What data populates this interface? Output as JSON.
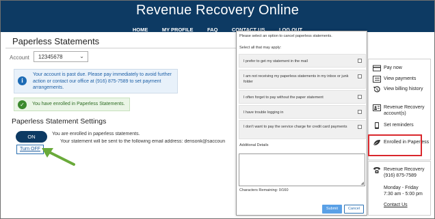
{
  "header": {
    "site_title": "Revenue Recovery Online",
    "nav": [
      "HOME",
      "MY PROFILE",
      "FAQ",
      "CONTACT US",
      "LOG OUT"
    ]
  },
  "page": {
    "title": "Paperless Statements",
    "account_label": "Account",
    "account_value": "12345678",
    "info_alert": "Your account is past due. Please pay immediately to avoid further action or contact our office at (916) 875-7589 to set payment arrangements.",
    "success_alert": "You have enrolled in Paperless Statements.",
    "settings_title": "Paperless Statement Settings",
    "toggle_label": "ON",
    "enrolled_text": "You are enrolled in paperless statements.",
    "email_text": "Your statement will be sent to the following email address:  densonk@saccoun",
    "turn_off_label": "Turn OFF"
  },
  "modal": {
    "prompt": "Please select an option to cancel paperless statements.",
    "select_all": "Select all that may apply:",
    "options": [
      "I prefer to get my statement in the mail",
      "I am not receiving my paperless statements in my inbox or junk folder",
      "I often forget to pay without the paper statement",
      "I have trouble logging in",
      "I don't want to pay the service charge for credit card payments"
    ],
    "details_label": "Additional Details",
    "details_value": "",
    "chars_remaining": "Characters Remaining: 0/160",
    "submit_label": "Submit",
    "cancel_label": "Cancel"
  },
  "sidebar": {
    "items": [
      {
        "label": "Pay now",
        "icon": "card-icon"
      },
      {
        "label": "View payments",
        "icon": "list-icon"
      },
      {
        "label": "View billing history",
        "icon": "history-icon"
      },
      {
        "label": "Revenue Recovery account(s)",
        "icon": "id-card-icon"
      },
      {
        "label": "Set reminders",
        "icon": "phone-icon"
      },
      {
        "label": "Enrolled in Paperless",
        "icon": "leaf-icon"
      }
    ],
    "contact": {
      "name": "Revenue Recovery",
      "phone": "(916) 875-7589",
      "hours_days": "Monday - Friday",
      "hours_time": "7:30 am - 5:00 pm",
      "link": "Contact Us"
    }
  },
  "colors": {
    "header_bg": "#0d3a63",
    "highlight_border": "#d9262b",
    "arrow": "#6aaa3a",
    "submit_bg": "#5aa0e6"
  }
}
